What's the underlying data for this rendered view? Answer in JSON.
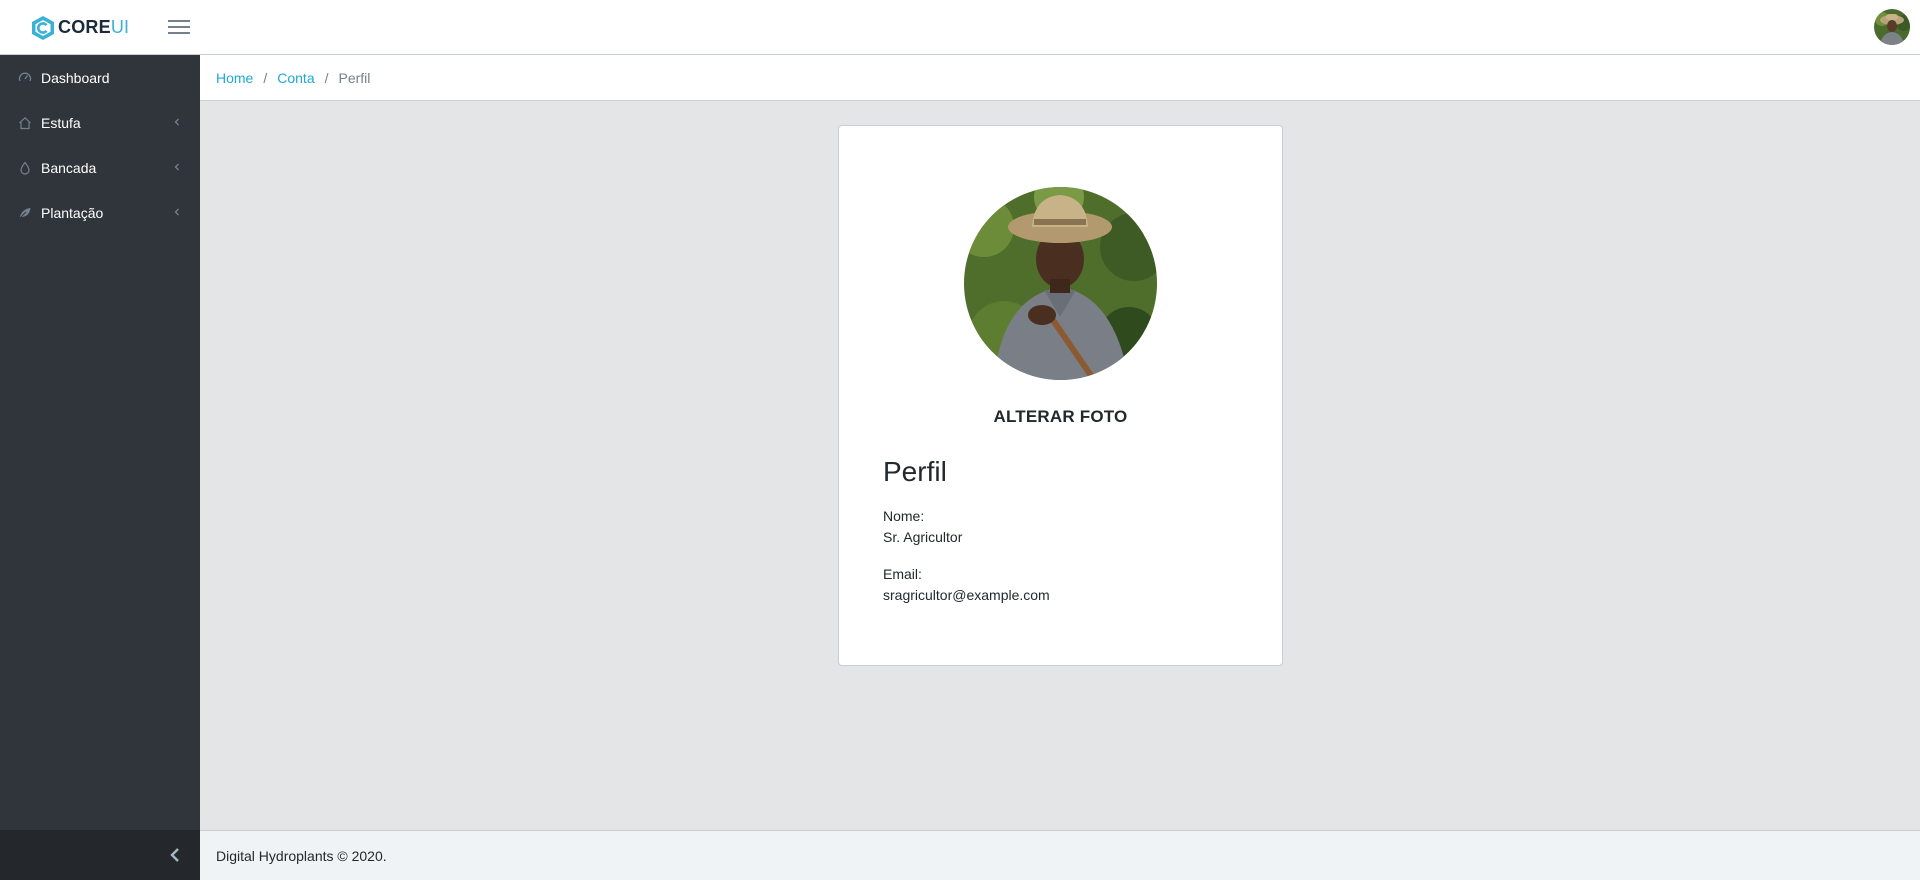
{
  "header": {
    "brand_core": "CORE",
    "brand_ui": "UI",
    "brand_accent": "#39b2d5"
  },
  "sidebar": {
    "items": [
      {
        "label": "Dashboard",
        "icon": "speedometer-icon",
        "has_children": false
      },
      {
        "label": "Estufa",
        "icon": "home-icon",
        "has_children": true
      },
      {
        "label": "Bancada",
        "icon": "drop-icon",
        "has_children": true
      },
      {
        "label": "Plantação",
        "icon": "leaf-icon",
        "has_children": true
      }
    ]
  },
  "breadcrumb": {
    "items": [
      "Home",
      "Conta",
      "Perfil"
    ]
  },
  "profile": {
    "change_photo_label": "ALTERAR FOTO",
    "title": "Perfil",
    "name_label": "Nome:",
    "name_value": "Sr. Agricultor",
    "email_label": "Email:",
    "email_value": "sragricultor@example.com"
  },
  "footer": {
    "text": "Digital Hydroplants © 2020."
  },
  "colors": {
    "sidebar_bg": "#2f353a",
    "link": "#20a8d8",
    "page_bg": "#e4e5e6"
  }
}
